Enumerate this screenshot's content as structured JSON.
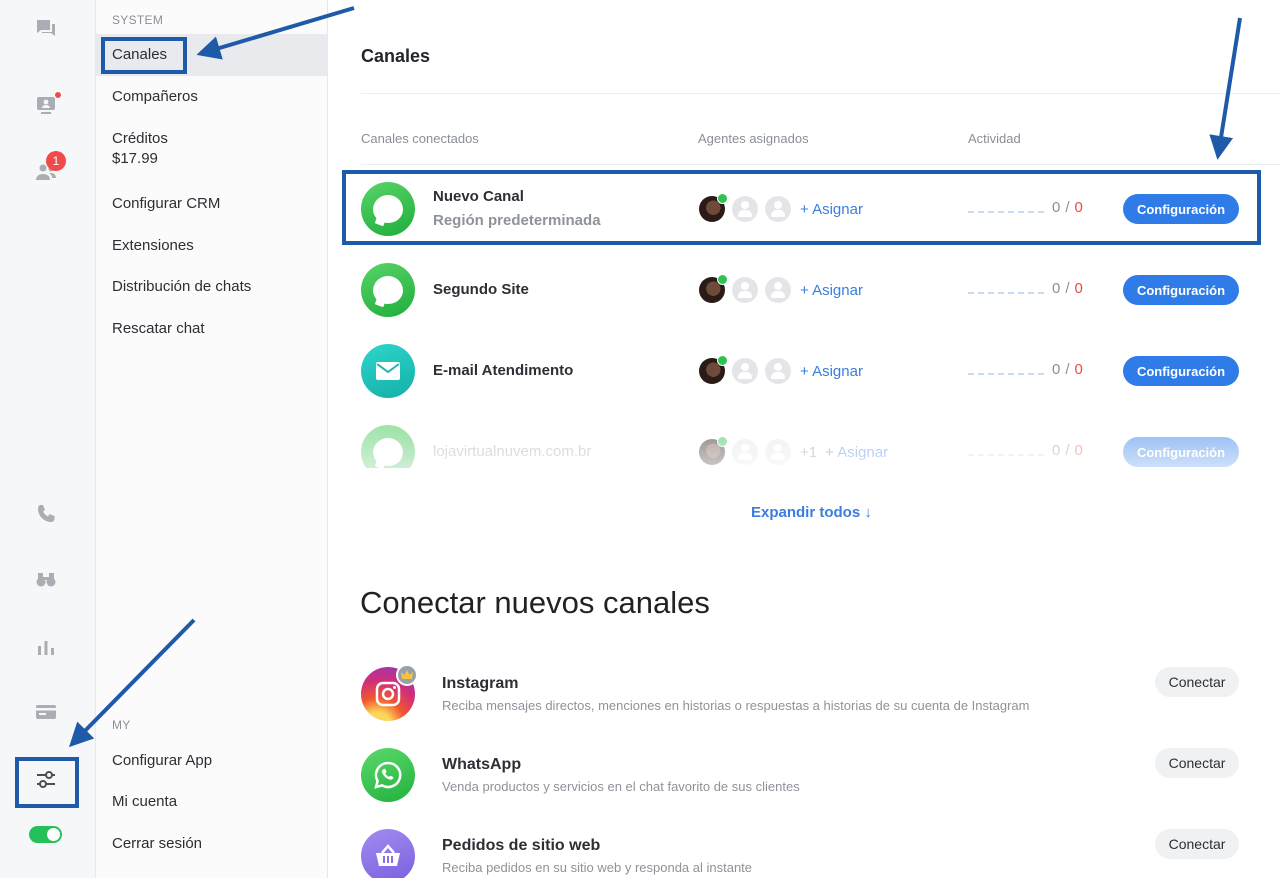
{
  "rail": {
    "icons": [
      "chats-icon",
      "visitors-icon",
      "contacts-icon",
      "phone-icon",
      "binoculars-icon",
      "reports-icon",
      "billing-icon",
      "settings-icon"
    ],
    "contacts_badge": "1",
    "accent": "#f04a4a",
    "toggle_on_color": "#26c05a"
  },
  "nav": {
    "system_label": "SYSTEM",
    "system_items": [
      {
        "label": "Canales",
        "active": true
      },
      {
        "label": "Compañeros"
      },
      {
        "label": "Créditos",
        "sub": "$17.99"
      },
      {
        "label": "Configurar CRM"
      },
      {
        "label": "Extensiones"
      },
      {
        "label": "Distribución de chats"
      },
      {
        "label": "Rescatar chat"
      }
    ],
    "my_label": "MY",
    "my_items": [
      {
        "label": "Configurar App"
      },
      {
        "label": "Mi cuenta"
      },
      {
        "label": "Cerrar sesión"
      }
    ]
  },
  "main": {
    "title": "Canales",
    "columns": {
      "connected": "Canales conectados",
      "agents": "Agentes asignados",
      "activity": "Actividad"
    },
    "channels": [
      {
        "name": "Nuevo Canal",
        "region": "Región predeterminada",
        "icon": "chat-bubble-icon",
        "assign": "+ Asignar",
        "count": "0",
        "sep": "/",
        "total": "0",
        "button": "Configuración"
      },
      {
        "name": "Segundo Site",
        "icon": "chat-bubble-icon",
        "assign": "+ Asignar",
        "count": "0",
        "sep": "/",
        "total": "0",
        "button": "Configuración"
      },
      {
        "name": "E-mail Atendimento",
        "icon": "mail-icon",
        "assign": "+ Asignar",
        "count": "0",
        "sep": "/",
        "total": "0",
        "button": "Configuración"
      },
      {
        "name": "lojavirtualnuvem.com.br",
        "icon": "chat-bubble-icon",
        "extra": "+1",
        "assign": "+ Asignar",
        "count": "0",
        "sep": "/",
        "total": "0",
        "button": "Configuración"
      }
    ],
    "expand_label": "Expandir todos ↓",
    "connect_title": "Conectar nuevos canales",
    "connect_items": [
      {
        "name": "Instagram",
        "desc": "Reciba mensajes directos, menciones en historias o respuestas a historias de su cuenta de Instagram",
        "button": "Conectar",
        "icon": "instagram-icon"
      },
      {
        "name": "WhatsApp",
        "desc": "Venda productos y servicios en el chat favorito de sus clientes",
        "button": "Conectar",
        "icon": "whatsapp-icon"
      },
      {
        "name": "Pedidos de sitio web",
        "desc": "Reciba pedidos en su sitio web y responda al instante",
        "button": "Conectar",
        "icon": "basket-icon"
      }
    ],
    "button_color": "#2f7ce8",
    "annotation_color": "#1f5aa8"
  }
}
